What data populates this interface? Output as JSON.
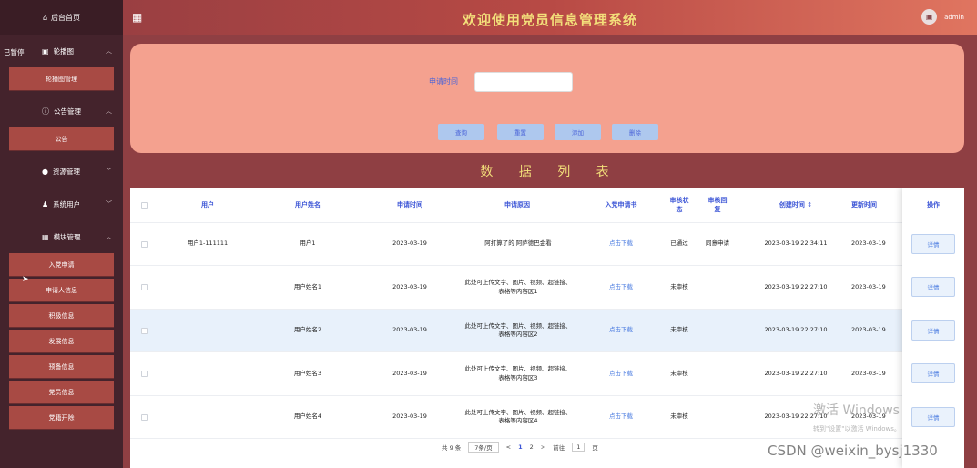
{
  "header": {
    "title": "欢迎使用党员信息管理系统",
    "user": "admin"
  },
  "sidebar": {
    "home": "后台首页",
    "paused": "已暂停",
    "groups": [
      {
        "label": "轮播图",
        "items": [
          "轮播图管理"
        ]
      },
      {
        "label": "公告管理",
        "items": [
          "公告"
        ]
      },
      {
        "label": "资源管理",
        "items": []
      },
      {
        "label": "系统用户",
        "items": []
      },
      {
        "label": "模块管理",
        "items": [
          "入党申请",
          "申请人信息",
          "积极信息",
          "发展信息",
          "预备信息",
          "党员信息",
          "党籍开除"
        ]
      }
    ]
  },
  "search": {
    "label": "申请时间",
    "placeholder": "",
    "buttons": [
      "查询",
      "重置",
      "添加",
      "删除"
    ]
  },
  "list_title": "数 据 列 表",
  "table": {
    "columns": [
      "用户",
      "用户姓名",
      "申请时间",
      "申请原因",
      "入党申请书",
      "审核状态",
      "审核回复",
      "创建时间 ⇕",
      "更新时间",
      "操作"
    ],
    "rows": [
      {
        "user": "用户1-111111",
        "name": "用户1",
        "date": "2023-03-19",
        "reason": "阿打算了的 阿萨德巴金看",
        "file": "点击下载",
        "status": "已通过",
        "reply": "同意申请",
        "created": "2023-03-19 22:34:11",
        "updated": "2023-03-19",
        "op": "详情"
      },
      {
        "user": "",
        "name": "用户姓名1",
        "date": "2023-03-19",
        "reason": "此处可上传文字、图片、视频、超链接、表格等内容区1",
        "file": "点击下载",
        "status": "未审核",
        "reply": "",
        "created": "2023-03-19 22:27:10",
        "updated": "2023-03-19",
        "op": "详情"
      },
      {
        "user": "",
        "name": "用户姓名2",
        "date": "2023-03-19",
        "reason": "此处可上传文字、图片、视频、超链接、表格等内容区2",
        "file": "点击下载",
        "status": "未审核",
        "reply": "",
        "created": "2023-03-19 22:27:10",
        "updated": "2023-03-19",
        "op": "详情"
      },
      {
        "user": "",
        "name": "用户姓名3",
        "date": "2023-03-19",
        "reason": "此处可上传文字、图片、视频、超链接、表格等内容区3",
        "file": "点击下载",
        "status": "未审核",
        "reply": "",
        "created": "2023-03-19 22:27:10",
        "updated": "2023-03-19",
        "op": "详情"
      },
      {
        "user": "",
        "name": "用户姓名4",
        "date": "2023-03-19",
        "reason": "此处可上传文字、图片、视频、超链接、表格等内容区4",
        "file": "点击下载",
        "status": "未审核",
        "reply": "",
        "created": "2023-03-19 22:27:10",
        "updated": "2023-03-19",
        "op": "详情"
      }
    ]
  },
  "pager": {
    "total": "共 9 条",
    "size": "7条/页",
    "prev": "<",
    "pages": [
      "1",
      "2"
    ],
    "next": ">",
    "goto": "前往",
    "page_input": "1",
    "unit": "页"
  },
  "watermark": {
    "line1": "激活 Windows",
    "line2": "转到\"设置\"以激活 Windows。",
    "csdn": "CSDN @weixin_bysj1330"
  }
}
